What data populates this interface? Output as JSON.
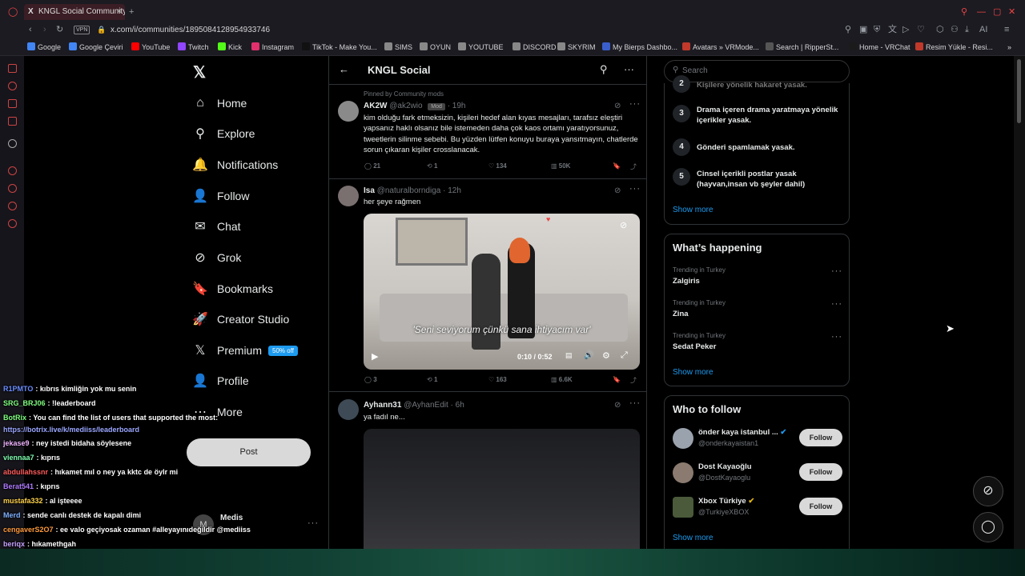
{
  "browser": {
    "tab_title": "KNGL Social Community /",
    "url": "x.com/i/communities/1895084128954933746",
    "vpn_label": "VPN",
    "bookmarks": [
      {
        "label": "Google",
        "color": "#4285f4"
      },
      {
        "label": "Google Çeviri",
        "color": "#4285f4"
      },
      {
        "label": "YouTube",
        "color": "#ff0000"
      },
      {
        "label": "Twitch",
        "color": "#9146ff"
      },
      {
        "label": "Kick",
        "color": "#53fc18"
      },
      {
        "label": "Instagram",
        "color": "#e1306c"
      },
      {
        "label": "TikTok - Make You...",
        "color": "#111111"
      },
      {
        "label": "SIMS",
        "color": "#888888"
      },
      {
        "label": "OYUN",
        "color": "#888888"
      },
      {
        "label": "YOUTUBE",
        "color": "#888888"
      },
      {
        "label": "DISCORD",
        "color": "#888888"
      },
      {
        "label": "SKYRIM",
        "color": "#888888"
      },
      {
        "label": "My Bierps Dashbo...",
        "color": "#3a5fcd"
      },
      {
        "label": "Avatars » VRMode...",
        "color": "#c0392b"
      },
      {
        "label": "Search | RipperSt...",
        "color": "#555555"
      },
      {
        "label": "Home - VRChat",
        "color": "#1b1b1b"
      },
      {
        "label": "Resim Yükle - Resi...",
        "color": "#c0392b"
      }
    ]
  },
  "nav": {
    "items": [
      {
        "label": "Home",
        "icon": "home-icon",
        "glyph": "⌂"
      },
      {
        "label": "Explore",
        "icon": "search-icon",
        "glyph": "⚲"
      },
      {
        "label": "Notifications",
        "icon": "bell-icon",
        "glyph": "🔔"
      },
      {
        "label": "Follow",
        "icon": "person-plus-icon",
        "glyph": "👤"
      },
      {
        "label": "Chat",
        "icon": "envelope-icon",
        "glyph": "✉"
      },
      {
        "label": "Grok",
        "icon": "grok-icon",
        "glyph": "⊘"
      },
      {
        "label": "Bookmarks",
        "icon": "bookmark-icon",
        "glyph": "🔖"
      },
      {
        "label": "Creator Studio",
        "icon": "rocket-icon",
        "glyph": "🚀"
      },
      {
        "label": "Premium",
        "icon": "x-logo-icon",
        "glyph": "𝕏"
      },
      {
        "label": "Profile",
        "icon": "person-icon",
        "glyph": "👤"
      },
      {
        "label": "More",
        "icon": "more-circle-icon",
        "glyph": "⋯"
      }
    ],
    "premium_badge": "50% off",
    "post_label": "Post",
    "account_name": "Medis",
    "account_initial": "M"
  },
  "feed": {
    "title": "KNGL Social",
    "pinned_label": "Pinned by Community mods",
    "tweets": [
      {
        "name": "AK2W",
        "handle": "@ak2wio",
        "badge": "Mod",
        "time": "· 19h",
        "text": "kim olduğu fark etmeksizin, kişileri hedef alan kıyas mesajları, tarafsız eleştiri yapsanız haklı olsanız bile istemeden daha çok kaos ortamı yaratıyorsunuz, tweetlerin silinme sebebi. Bu yüzden lütfen konuyu buraya yansıtmayın, chatlerde sorun çıkaran kişiler crosslanacak.",
        "replies": "21",
        "reposts": "1",
        "likes": "134",
        "views": "50K"
      },
      {
        "name": "Isa",
        "handle": "@naturalborndiga",
        "time": "· 12h",
        "text": "her şeye rağmen",
        "video_caption": "'Seni seviyorum çünkü sana ihtiyacım var'",
        "video_time": "0:10 / 0:52",
        "replies": "3",
        "reposts": "1",
        "likes": "163",
        "views": "6.6K"
      },
      {
        "name": "Ayhann31",
        "handle": "@AyhanEdit",
        "time": "· 6h",
        "text": "ya fadıl ne..."
      }
    ]
  },
  "sidebar": {
    "search_placeholder": "Search",
    "rules_partial": "Kişilere yönelik hakaret yasak.",
    "rules": [
      {
        "num": "3",
        "text": "Drama içeren drama yaratmaya yönelik içerikler yasak."
      },
      {
        "num": "4",
        "text": "Gönderi spamlamak yasak."
      },
      {
        "num": "5",
        "text": "Cinsel içerikli postlar yasak (hayvan,insan vb şeyler dahil)"
      }
    ],
    "show_more": "Show more",
    "happening_title": "What’s happening",
    "trends": [
      {
        "meta": "Trending in Turkey",
        "name": "Zalgiris"
      },
      {
        "meta": "Trending in Turkey",
        "name": "Zina"
      },
      {
        "meta": "Trending in Turkey",
        "name": "Sedat Peker"
      }
    ],
    "wtf_title": "Who to follow",
    "who_to_follow": [
      {
        "name": "önder kaya istanbul ...",
        "handle": "@onderkayaistan1",
        "verified": "blue"
      },
      {
        "name": "Dost Kayaoğlu",
        "handle": "@DostKayaoglu"
      },
      {
        "name": "Xbox Türkiye",
        "handle": "@TurkiyeXBOX",
        "verified": "gold"
      }
    ],
    "follow_label": "Follow"
  },
  "chat": [
    {
      "user": "R1PMTO",
      "color": "#6a8cff",
      "msg": ": kıbrıs kimliğin yok mu senin"
    },
    {
      "user": "SRG_BRJ06",
      "color": "#7fff7f",
      "msg": ": !leaderboard"
    },
    {
      "user": "BotRix",
      "color": "#7fff7f",
      "msg": ": You can find the list of users that supported the most:"
    },
    {
      "user": "",
      "color": "#9aa6ff",
      "msg": "https://botrix.live/k/mediiss/leaderboard"
    },
    {
      "user": "jekase9",
      "color": "#f0b4ff",
      "msg": ": ney istedi bidaha söylesene"
    },
    {
      "user": "viennaa7",
      "color": "#7fffb0",
      "msg": ": kıprıs"
    },
    {
      "user": "abdullahssnr",
      "color": "#ff5a5a",
      "msg": ": hıkamet mıl o ney ya kktc de öylr mi"
    },
    {
      "user": "Berat541",
      "color": "#b07aff",
      "msg": ": kıprıs"
    },
    {
      "user": "mustafa332",
      "color": "#ffd24a",
      "msg": ": al işteeee"
    },
    {
      "user": "Merd",
      "color": "#7fb0ff",
      "msg": ": sende canlı destek de kapalı dimi"
    },
    {
      "user": "cengaverS2O7",
      "color": "#ff9a3a",
      "msg": ": ee valo geçiyosak ozaman #alleyayınıdeğildir @mediiss"
    },
    {
      "user": "beriqx",
      "color": "#c6a0ff",
      "msg": ": hıkamethgah"
    }
  ]
}
